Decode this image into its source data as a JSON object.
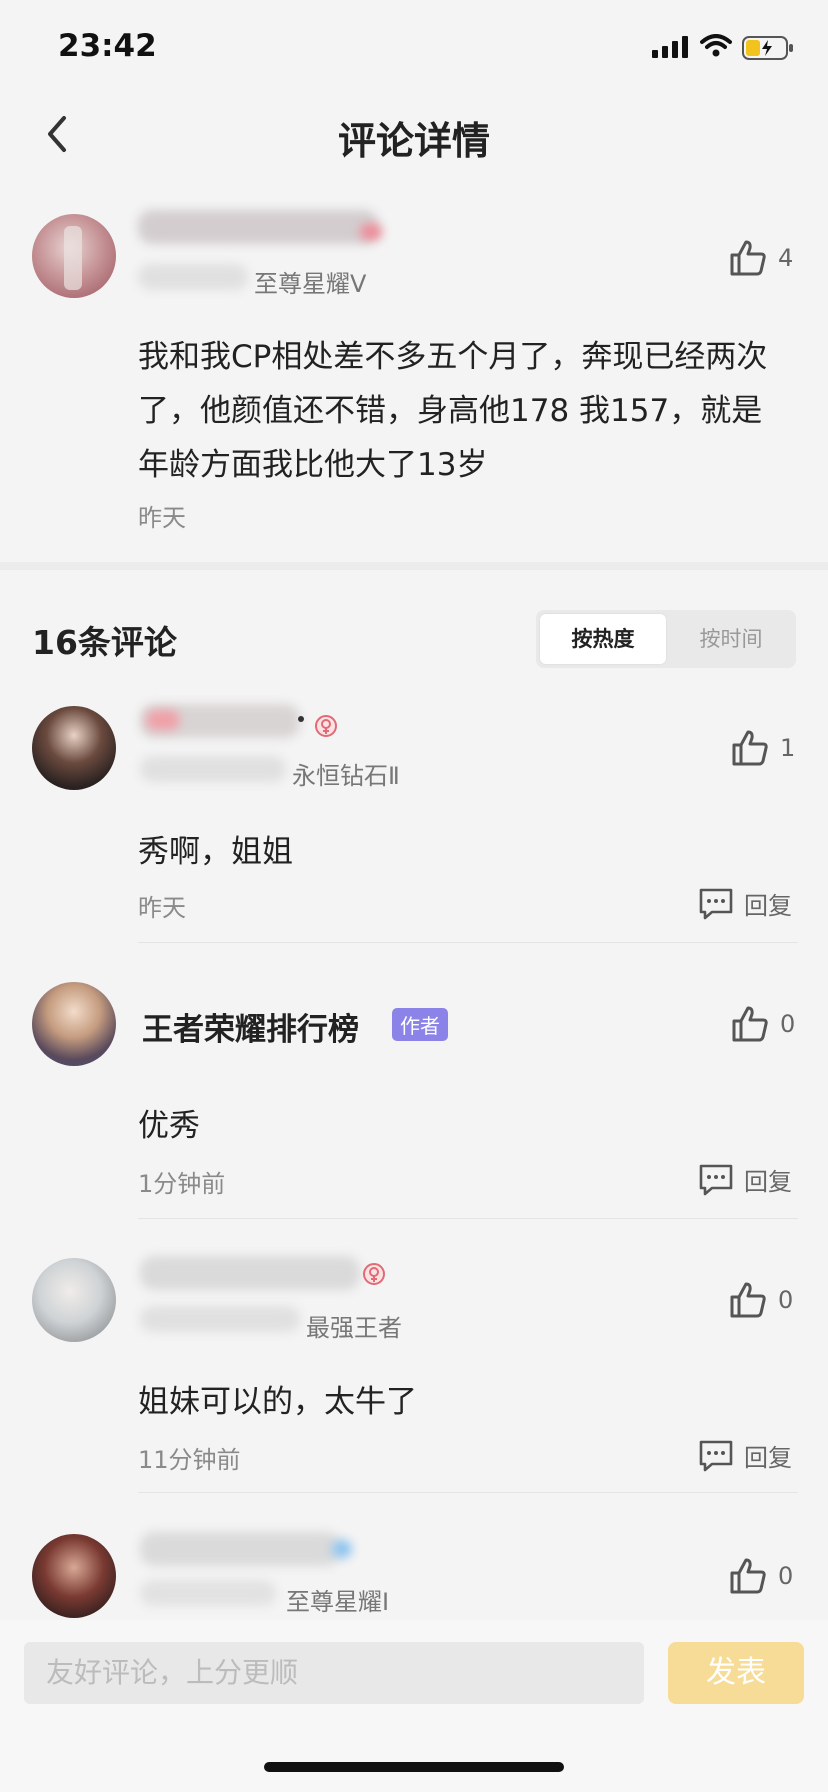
{
  "status_bar": {
    "time": "23:42"
  },
  "header": {
    "title": "评论详情"
  },
  "post": {
    "rank": "至尊星耀Ⅴ",
    "likes": "4",
    "text": "我和我CP相处差不多五个月了，奔现已经两次了，他颜值还不错，身高他178 我157，就是年龄方面我比他大了13岁",
    "time": "昨天"
  },
  "comments_header": {
    "count_label": "16条评论",
    "sort_hot": "按热度",
    "sort_time": "按时间"
  },
  "comments": [
    {
      "name": "",
      "rank": "永恒钻石Ⅱ",
      "likes": "1",
      "text": "秀啊，姐姐",
      "time": "昨天",
      "reply": "回复"
    },
    {
      "name": "王者荣耀排行榜",
      "badge": "作者",
      "likes": "0",
      "text": "优秀",
      "time": "1分钟前",
      "reply": "回复"
    },
    {
      "name": "",
      "rank": "最强王者",
      "likes": "0",
      "text": "姐妹可以的，太牛了",
      "time": "11分钟前",
      "reply": "回复"
    },
    {
      "name": "",
      "rank": "至尊星耀Ⅰ",
      "likes": "0"
    }
  ],
  "composer": {
    "placeholder": "友好评论，上分更顺",
    "send_label": "发表"
  }
}
